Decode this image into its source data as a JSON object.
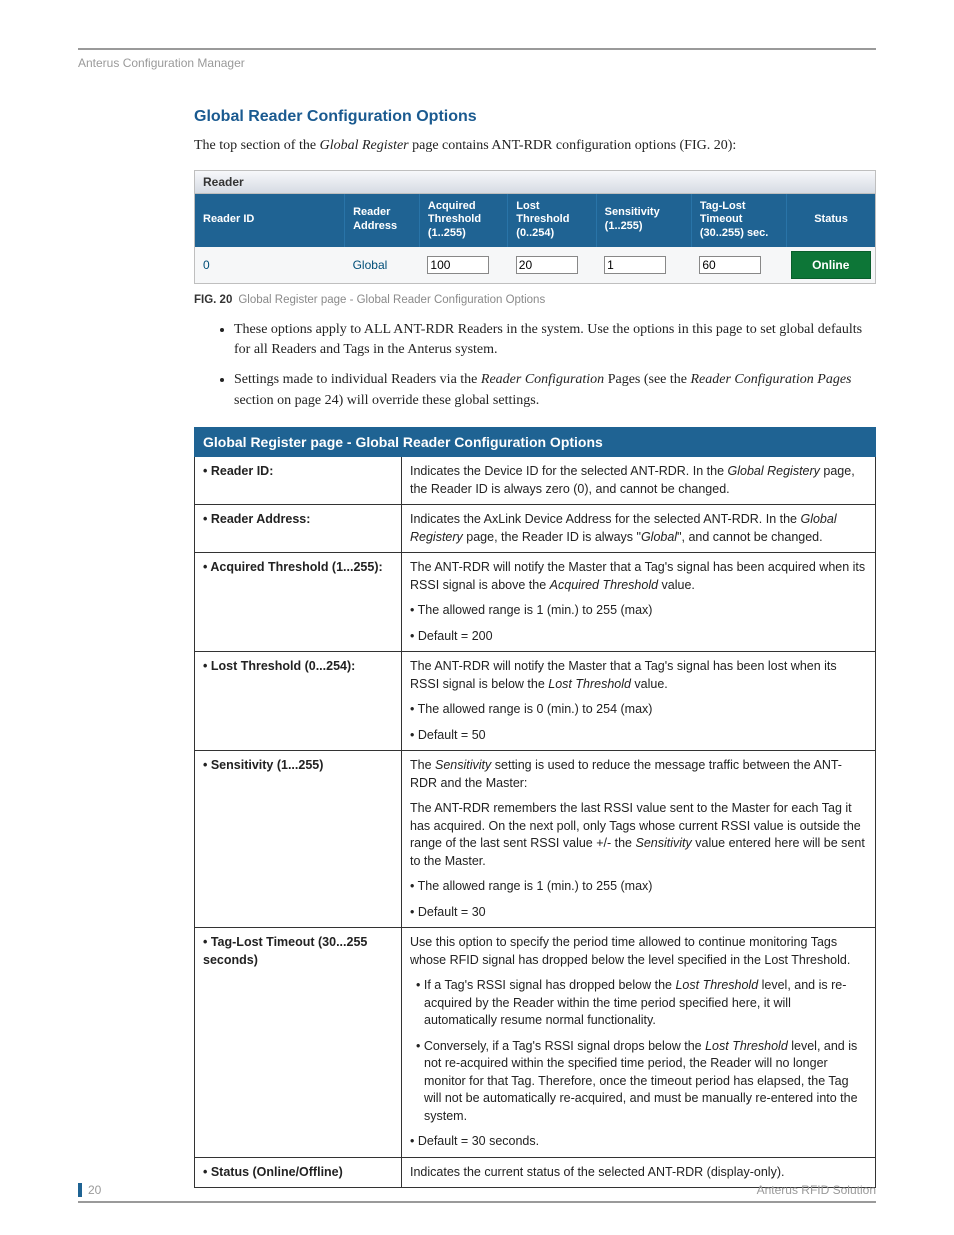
{
  "runningHead": "Anterus Configuration Manager",
  "sectionTitle": "Global Reader Configuration Options",
  "intro": {
    "pre": "The top section of the ",
    "em": "Global Register",
    "post": " page contains ANT-RDR configuration options (FIG. 20):"
  },
  "readerPanel": {
    "title": "Reader",
    "headers": {
      "readerId": "Reader ID",
      "readerAddress": "Reader Address",
      "acquired": "Acquired Threshold (1..255)",
      "lost": "Lost Threshold (0..254)",
      "sensitivity": "Sensitivity (1..255)",
      "tagLost": "Tag-Lost Timeout (30..255) sec.",
      "status": "Status"
    },
    "row": {
      "readerId": "0",
      "readerAddress": "Global",
      "acquired": "100",
      "lost": "20",
      "sensitivity": "1",
      "tagLost": "60",
      "status": "Online"
    }
  },
  "figCaption": {
    "label": "FIG. 20",
    "text": "Global Register page - Global Reader Configuration Options"
  },
  "bullets": {
    "b1": "These options apply to ALL ANT-RDR Readers in the system. Use the options in this page to set global defaults for all Readers and Tags in the Anterus system.",
    "b2": {
      "pre": "Settings made to individual Readers via the ",
      "em1": "Reader Configuration",
      "mid": " Pages (see the ",
      "em2": "Reader Configuration Pages",
      "post": " section on page 24) will override these global settings."
    }
  },
  "descTable": {
    "title": "Global Register page - Global Reader Configuration Options",
    "rows": [
      {
        "name": "• Reader ID:",
        "body": {
          "p1": {
            "pre": "Indicates the Device ID for the selected ANT-RDR. In the ",
            "em": "Global Registery",
            "post": " page, the Reader ID is always zero (0), and cannot be changed."
          }
        }
      },
      {
        "name": "• Reader Address:",
        "body": {
          "p1": {
            "pre": "Indicates the AxLink Device Address for the selected ANT-RDR. In the ",
            "em": "Global Registery",
            "post2pre": " page, the Reader ID is always \"",
            "em2": "Global",
            "post": "\", and cannot be changed."
          }
        }
      },
      {
        "name": "• Acquired Threshold (1...255):",
        "body": {
          "p1": {
            "pre": "The ANT-RDR will notify the Master that a Tag's signal has been acquired when its RSSI signal is above the ",
            "em": "Acquired Threshold",
            "post": " value."
          },
          "sub1": "• The allowed range is 1 (min.) to 255 (max)",
          "sub2": "• Default = 200"
        }
      },
      {
        "name": "• Lost Threshold (0...254):",
        "body": {
          "p1": {
            "pre": "The ANT-RDR will notify the Master that a Tag's signal has been lost when its RSSI signal is below the ",
            "em": "Lost Threshold",
            "post": " value."
          },
          "sub1": "• The allowed range is 0 (min.) to 254 (max)",
          "sub2": "• Default = 50"
        }
      },
      {
        "name": "• Sensitivity (1...255)",
        "body": {
          "p1": {
            "pre": "The ",
            "em": "Sensitivity",
            "post": " setting is used to reduce the message traffic between the ANT-RDR and the Master:"
          },
          "p2": {
            "pre": "The ANT-RDR remembers the last RSSI value sent to the Master for each Tag it has acquired. On the next poll, only Tags whose current RSSI value is outside the range of the last sent RSSI value +/- the ",
            "em": "Sensitivity",
            "post": " value entered here will be sent to the Master."
          },
          "sub1": "• The allowed range is 1 (min.) to 255 (max)",
          "sub2": "• Default = 30"
        }
      },
      {
        "name": "• Tag-Lost Timeout (30...255 seconds)",
        "body": {
          "p1": {
            "text": "Use this option to specify the period time allowed to continue monitoring Tags whose RFID signal has dropped below the level specified in the Lost Threshold."
          },
          "b1": {
            "pre": "• If a Tag's RSSI signal has dropped below the ",
            "em": "Lost Threshold",
            "post": " level, and is re-acquired by the Reader within the time period specified here, it will automatically resume normal functionality."
          },
          "b2": {
            "pre": "• Conversely, if a Tag's RSSI signal drops below the ",
            "em": "Lost Threshold",
            "post": " level, and is not re-acquired within the specified time period, the Reader will no longer monitor for that Tag. Therefore, once the timeout period has elapsed, the Tag will not be automatically re-acquired, and must be manually re-entered into the system."
          },
          "sub1": "• Default = 30 seconds."
        }
      },
      {
        "name": "• Status (Online/Offline)",
        "body": {
          "p1": {
            "text": "Indicates the current status of the selected ANT-RDR (display-only)."
          }
        }
      }
    ]
  },
  "footer": {
    "pageNumber": "20",
    "docTitle": "Anterus RFID Solution"
  }
}
